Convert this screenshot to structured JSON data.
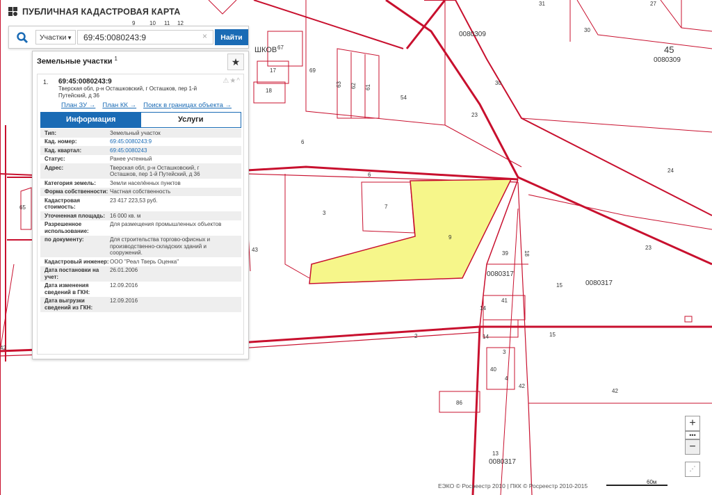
{
  "app": {
    "title": "ПУБЛИЧНАЯ КАДАСТРОВАЯ КАРТА"
  },
  "search": {
    "type_label": "Участки",
    "value": "69:45:0080243:9",
    "clear": "×",
    "button": "Найти"
  },
  "results": {
    "heading": "Земельные участки",
    "count": "1",
    "star": "★",
    "item": {
      "number": "1.",
      "cad_number": "69:45:0080243:9",
      "address": "Тверская обл, р-н Осташковский, г Осташков, пер 1-й Путейский, д 36",
      "icons": "⚠★^",
      "links": [
        "План ЗУ →",
        "План КК →",
        "Поиск в границах объекта →"
      ]
    },
    "tabs": [
      "Информация",
      "Услуги"
    ],
    "rows": [
      {
        "k": "Тип:",
        "v": "Земельный участок"
      },
      {
        "k": "Кад. номер:",
        "v": "69:45:0080243:9"
      },
      {
        "k": "Кад. квартал:",
        "v": "69:45:0080243"
      },
      {
        "k": "Статус:",
        "v": "Ранее учтенный"
      },
      {
        "k": "Адрес:",
        "v": "Тверская обл, р-н Осташковский, г Осташков, пер 1-й Путейский, д 36"
      },
      {
        "k": "Категория земель:",
        "v": "Земли населённых пунктов"
      },
      {
        "k": "Форма собственности:",
        "v": "Частная собственность"
      },
      {
        "k": "Кадастровая стоимость:",
        "v": "23 417 223,53 руб."
      },
      {
        "k": "Уточненная площадь:",
        "v": "16 000 кв. м"
      },
      {
        "k": "Разрешенное использование:",
        "v": "Для размещения промышленных объектов"
      },
      {
        "k": "по документу:",
        "v": "Для строительства торгово-офисных и производственно-складских зданий и сооружений."
      },
      {
        "k": "Кадастровый инженер:",
        "v": "ООО \"Реал Тверь Оценка\""
      },
      {
        "k": "Дата постановки на учет:",
        "v": "26.01.2006"
      },
      {
        "k": "Дата изменения сведений в ГКН:",
        "v": "12.09.2016"
      },
      {
        "k": "Дата выгрузки сведений из ГКН:",
        "v": "12.09.2016"
      }
    ]
  },
  "map": {
    "labels": [
      "0080309",
      "0080309",
      "45",
      "31",
      "27",
      "30",
      "30",
      "23",
      "24",
      "23",
      "ШКОВ",
      "67",
      "69",
      "17",
      "18",
      "63",
      "62",
      "61",
      "54",
      "6",
      "6",
      "3",
      "7",
      "9",
      "39",
      "18",
      "0080317",
      "15",
      "0080317",
      "41",
      "14",
      "14",
      "15",
      "2",
      "3",
      "40",
      "4",
      "42",
      "42",
      "86",
      "13",
      "0080317",
      "65",
      "43",
      "42",
      "9",
      "10",
      "11",
      "12"
    ],
    "highlight_color": "#f6f68a",
    "line_color": "#c8102e"
  },
  "controls": {
    "zoom_in": "+",
    "dots": "•••",
    "zoom_out": "−",
    "fullscreen": "⋰"
  },
  "footer": {
    "copyright": "ЕЭКО © Росреестр 2010 | ПКК © Росреестр 2010-2015",
    "scale": "60м"
  }
}
